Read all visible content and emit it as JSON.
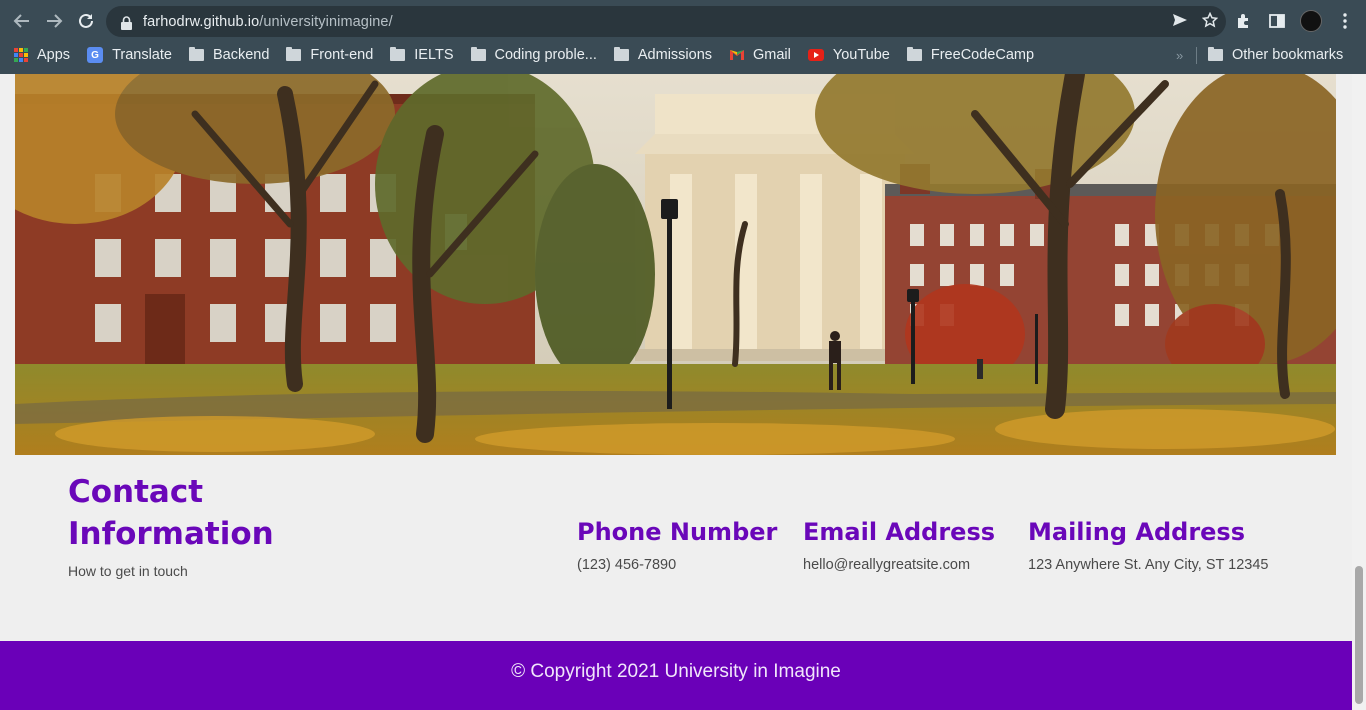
{
  "browser": {
    "url_host": "farhodrw.github.io",
    "url_path": "/universityinimagine/",
    "bookmarks": [
      {
        "label": "Apps",
        "icon": "apps-grid-icon"
      },
      {
        "label": "Translate",
        "icon": "google-translate-icon"
      },
      {
        "label": "Backend",
        "icon": "folder-icon"
      },
      {
        "label": "Front-end",
        "icon": "folder-icon"
      },
      {
        "label": "IELTS",
        "icon": "folder-icon"
      },
      {
        "label": "Coding proble...",
        "icon": "folder-icon"
      },
      {
        "label": "Admissions",
        "icon": "folder-icon"
      },
      {
        "label": "Gmail",
        "icon": "gmail-icon"
      },
      {
        "label": "YouTube",
        "icon": "youtube-icon"
      },
      {
        "label": "FreeCodeCamp",
        "icon": "folder-icon"
      }
    ],
    "more_bookmarks": "»",
    "other_bookmarks": "Other bookmarks"
  },
  "hero": {
    "image": "campus-photo"
  },
  "contact": {
    "title": "Contact Information",
    "subtitle": "How to get in touch",
    "phone_heading": "Phone Number",
    "phone_value": "(123) 456-7890",
    "email_heading": "Email Address",
    "email_value": "hello@reallygreatsite.com",
    "mail_heading": "Mailing Address",
    "mail_value": "123 Anywhere St. Any City, ST 12345"
  },
  "footer": {
    "copyright": "© Copyright 2021 University in Imagine"
  },
  "colors": {
    "accent": "#6a07b9",
    "footer_bg": "#6a00b8",
    "chrome_bg": "#3a4b55"
  }
}
